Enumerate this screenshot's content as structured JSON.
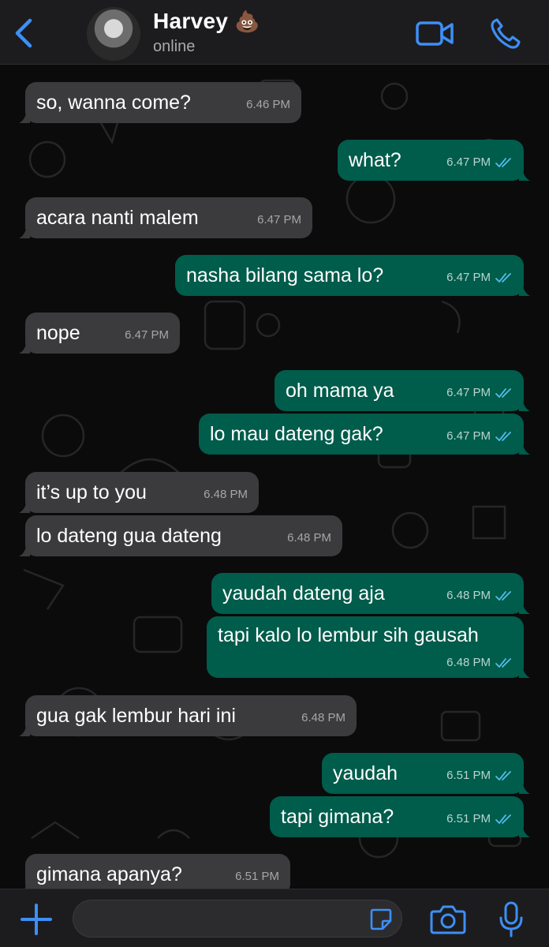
{
  "header": {
    "contact_name": "Harvey",
    "contact_emoji": "💩",
    "status": "online",
    "accent_color": "#3d8ff5"
  },
  "icons": {
    "back": "chevron-left-icon",
    "video": "video-camera-icon",
    "call": "phone-icon",
    "add": "plus-icon",
    "sticker": "sticker-icon",
    "camera": "camera-icon",
    "mic": "microphone-icon"
  },
  "messages": [
    {
      "direction": "in",
      "text": "so, wanna come?",
      "time": "6.46 PM"
    },
    {
      "direction": "out",
      "text": "what?",
      "time": "6.47 PM",
      "read": true
    },
    {
      "direction": "in",
      "text": "acara nanti malem",
      "time": "6.47 PM"
    },
    {
      "direction": "out",
      "text": "nasha bilang sama lo?",
      "time": "6.47 PM",
      "read": true
    },
    {
      "direction": "in",
      "text": "nope",
      "time": "6.47 PM"
    },
    {
      "direction": "out",
      "text": "oh mama ya",
      "time": "6.47 PM",
      "read": true
    },
    {
      "direction": "out",
      "text": "lo mau dateng gak?",
      "time": "6.47 PM",
      "read": true
    },
    {
      "direction": "in",
      "text": "it’s up to you",
      "time": "6.48 PM"
    },
    {
      "direction": "in",
      "text": "lo dateng gua dateng",
      "time": "6.48 PM"
    },
    {
      "direction": "out",
      "text": "yaudah dateng aja",
      "time": "6.48 PM",
      "read": true
    },
    {
      "direction": "out",
      "text": "tapi kalo lo lembur sih gausah",
      "time": "6.48 PM",
      "read": true
    },
    {
      "direction": "in",
      "text": "gua gak lembur hari ini",
      "time": "6.48 PM"
    },
    {
      "direction": "out",
      "text": "yaudah",
      "time": "6.51 PM",
      "read": true
    },
    {
      "direction": "out",
      "text": "tapi gimana?",
      "time": "6.51 PM",
      "read": true
    },
    {
      "direction": "in",
      "text": "gimana apanya?",
      "time": "6.51 PM"
    }
  ],
  "composer": {
    "value": "",
    "placeholder": ""
  }
}
